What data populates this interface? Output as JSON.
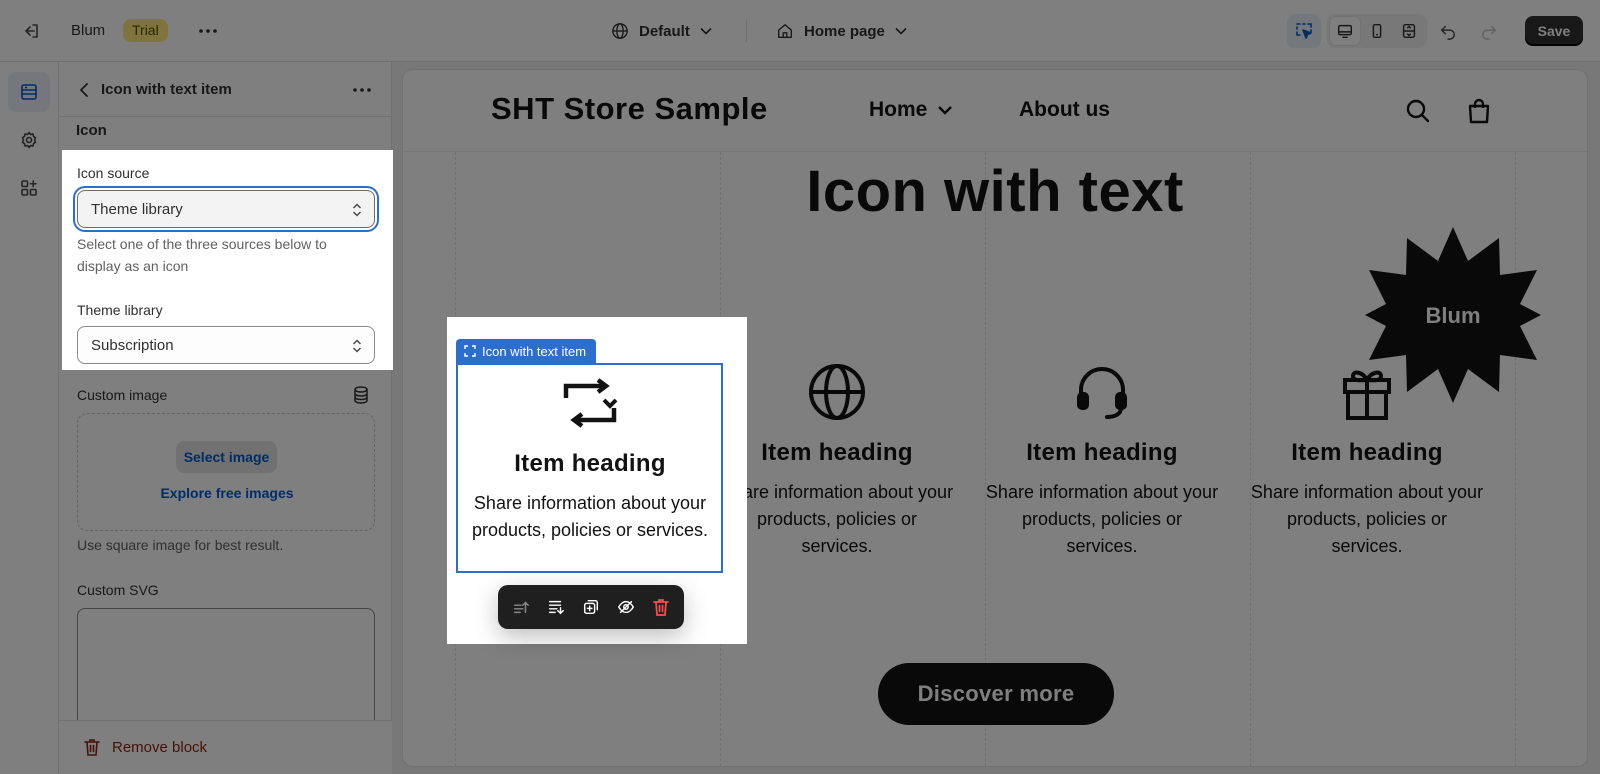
{
  "topbar": {
    "app_name": "Blum",
    "badge": "Trial",
    "theme": "Default",
    "page": "Home page",
    "save_label": "Save"
  },
  "panel": {
    "title": "Icon with text item",
    "group_heading": "Icon",
    "icon_source_label": "Icon source",
    "icon_source_value": "Theme library",
    "icon_source_help": "Select one of the three sources below to display as an icon",
    "theme_library_label": "Theme library",
    "theme_library_value": "Subscription",
    "custom_image_label": "Custom image",
    "select_image_label": "Select image",
    "explore_label": "Explore free images",
    "image_hint": "Use square image for best result.",
    "custom_svg_label": "Custom SVG",
    "remove_label": "Remove block"
  },
  "preview": {
    "store_name": "SHT Store Sample",
    "nav": [
      "Home",
      "About us"
    ],
    "section_title": "Icon with text",
    "badge_text": "Blum",
    "items": [
      {
        "icon": "subscription-icon",
        "heading": "Item heading",
        "text": "Share information about your products, policies or services."
      },
      {
        "icon": "globe-icon",
        "heading": "Item heading",
        "text": "Share information about your products, policies or services."
      },
      {
        "icon": "headset-icon",
        "heading": "Item heading",
        "text": "Share information about your products, policies or services."
      },
      {
        "icon": "gift-icon",
        "heading": "Item heading",
        "text": "Share information about your products, policies or services."
      }
    ],
    "button_label": "Discover more"
  },
  "selection": {
    "tag_label": "Icon with text item"
  },
  "colors": {
    "accent": "#2c6ecb",
    "link": "#005bd3",
    "critical": "#e51c00",
    "badge_bg": "#ffeb78"
  }
}
